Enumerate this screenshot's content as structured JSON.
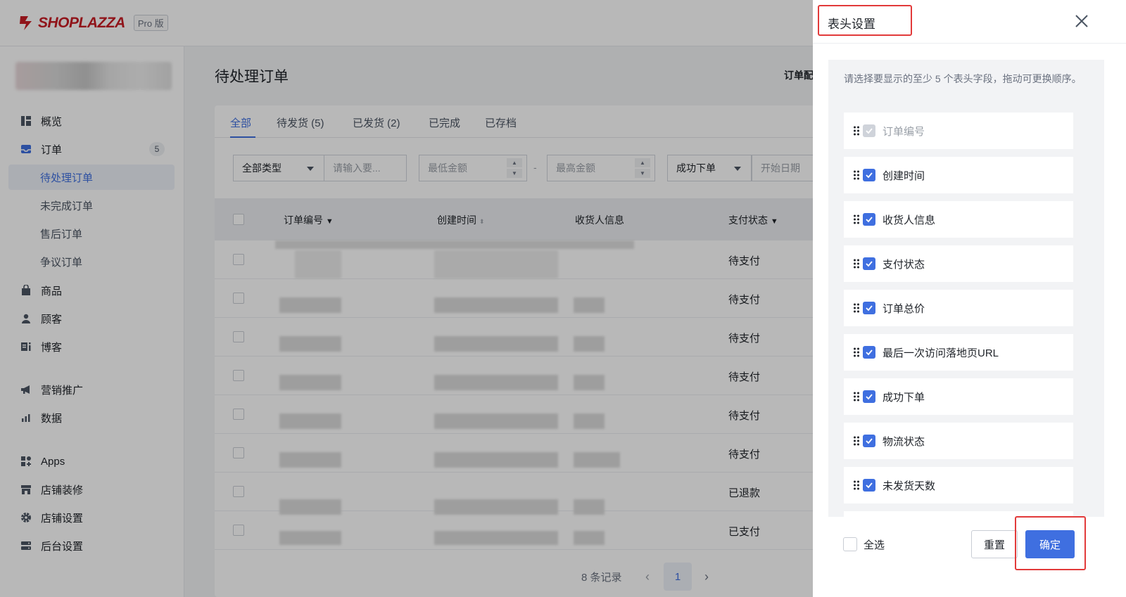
{
  "brand": {
    "name": "SHOPLAZZA",
    "edition": "Pro 版",
    "color": "#c81d25"
  },
  "sidebar": {
    "items": [
      {
        "label": "概览",
        "icon": "dashboard-icon"
      },
      {
        "label": "订单",
        "icon": "inbox-icon",
        "count": "5"
      },
      {
        "label": "待处理订单",
        "sub": true,
        "active": true
      },
      {
        "label": "未完成订单",
        "sub": true
      },
      {
        "label": "售后订单",
        "sub": true
      },
      {
        "label": "争议订单",
        "sub": true
      },
      {
        "label": "商品",
        "icon": "bag-icon"
      },
      {
        "label": "顾客",
        "icon": "person-icon"
      },
      {
        "label": "博客",
        "icon": "blog-icon"
      },
      {
        "label": "营销推广",
        "icon": "megaphone-icon"
      },
      {
        "label": "数据",
        "icon": "bar-chart-icon"
      },
      {
        "label": "Apps",
        "icon": "apps-icon"
      },
      {
        "label": "店铺装修",
        "icon": "storefront-icon"
      },
      {
        "label": "店铺设置",
        "icon": "gear-icon"
      },
      {
        "label": "后台设置",
        "icon": "server-icon"
      }
    ]
  },
  "main": {
    "title": "待处理订单",
    "header_right": "订单配",
    "tabs": [
      "全部",
      "待发货 (5)",
      "已发货 (2)",
      "已完成",
      "已存档"
    ],
    "filters": {
      "type_select": "全部类型",
      "search_placeholder": "请输入要...",
      "min_amount_placeholder": "最低金额",
      "separator": "-",
      "max_amount_placeholder": "最高金额",
      "status_select": "成功下单",
      "start_date_placeholder": "开始日期"
    },
    "table": {
      "columns": [
        "订单编号",
        "创建时间",
        "收货人信息",
        "支付状态"
      ],
      "rows": [
        {
          "status": "待支付"
        },
        {
          "status": "待支付"
        },
        {
          "status": "待支付"
        },
        {
          "status": "待支付"
        },
        {
          "status": "待支付"
        },
        {
          "status": "待支付"
        },
        {
          "status": "已退款"
        },
        {
          "status": "已支付"
        }
      ]
    },
    "pagination": {
      "records": "8 条记录",
      "current_page": "1"
    }
  },
  "drawer": {
    "title": "表头设置",
    "description": "请选择要显示的至少 5 个表头字段，拖动可更换顺序。",
    "fields": [
      {
        "label": "订单编号",
        "checked": true,
        "disabled": true
      },
      {
        "label": "创建时间",
        "checked": true
      },
      {
        "label": "收货人信息",
        "checked": true
      },
      {
        "label": "支付状态",
        "checked": true
      },
      {
        "label": "订单总价",
        "checked": true
      },
      {
        "label": "最后一次访问落地页URL",
        "checked": true
      },
      {
        "label": "成功下单",
        "checked": true
      },
      {
        "label": "物流状态",
        "checked": true
      },
      {
        "label": "未发货天数",
        "checked": true
      }
    ],
    "select_all_label": "全选",
    "reset_label": "重置",
    "confirm_label": "确定",
    "accent_color": "#3f6fe0",
    "highlight_color": "#e23a3a"
  }
}
